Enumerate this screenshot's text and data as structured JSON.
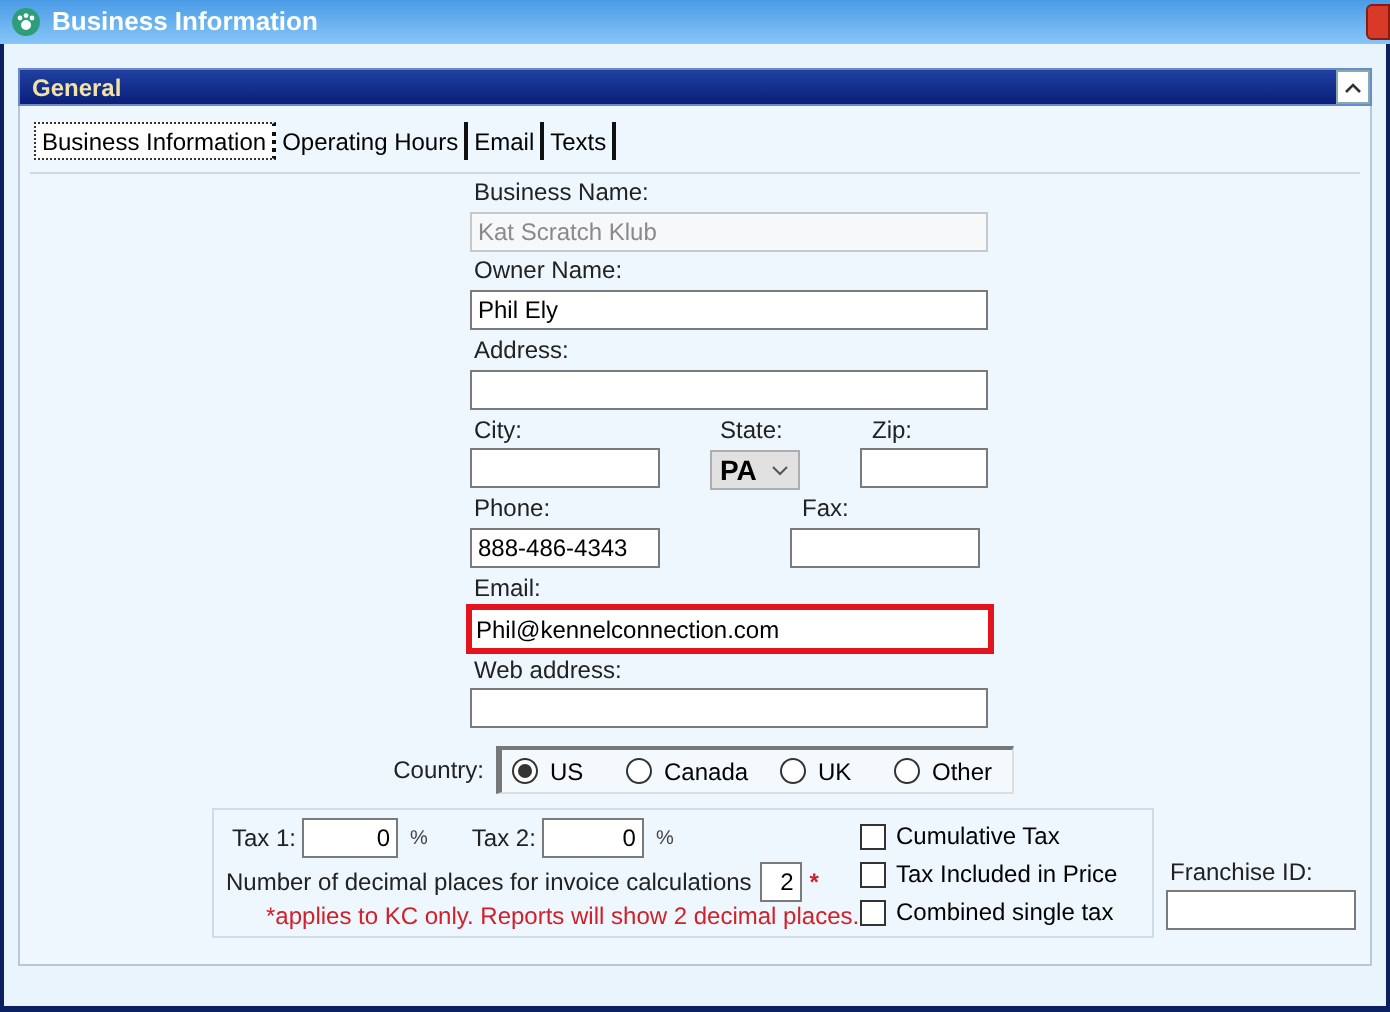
{
  "window": {
    "title": "Business Information"
  },
  "panel": {
    "title": "General",
    "expanded": true
  },
  "tabs": [
    {
      "label": "Business Information",
      "selected": true
    },
    {
      "label": "Operating Hours",
      "selected": false
    },
    {
      "label": "Email",
      "selected": false
    },
    {
      "label": "Texts",
      "selected": false
    }
  ],
  "business_name": {
    "label": "Business Name:",
    "value": "Kat Scratch Klub",
    "disabled": true
  },
  "owner_name": {
    "label": "Owner Name:",
    "value": "Phil Ely"
  },
  "address": {
    "label": "Address:"
  },
  "city": {
    "label": "City:"
  },
  "state": {
    "label": "State:",
    "value": "PA"
  },
  "zip": {
    "label": "Zip:"
  },
  "phone": {
    "label": "Phone:",
    "value": "888-486-4343"
  },
  "fax": {
    "label": "Fax:"
  },
  "email": {
    "label": "Email:",
    "value": "Phil@kennelconnection.com",
    "highlighted": true
  },
  "web_address": {
    "label": "Web address:"
  },
  "country": {
    "label": "Country:",
    "options": [
      {
        "label": "US",
        "selected": true
      },
      {
        "label": "Canada",
        "selected": false
      },
      {
        "label": "UK",
        "selected": false
      },
      {
        "label": "Other",
        "selected": false
      }
    ]
  },
  "tax1": {
    "label": "Tax 1:",
    "value": "0",
    "unit": "%"
  },
  "tax2": {
    "label": "Tax 2:",
    "value": "0",
    "unit": "%"
  },
  "decimal_places": {
    "label": "Number of decimal places for invoice calculations",
    "value": "2",
    "required_mark": "*"
  },
  "decimal_note": "*applies to KC only. Reports will show 2 decimal places.",
  "tax_options": [
    {
      "label": "Cumulative Tax",
      "checked": false
    },
    {
      "label": "Tax Included in Price",
      "checked": false
    },
    {
      "label": "Combined single tax",
      "checked": false
    }
  ],
  "franchise_id": {
    "label": "Franchise ID:"
  }
}
